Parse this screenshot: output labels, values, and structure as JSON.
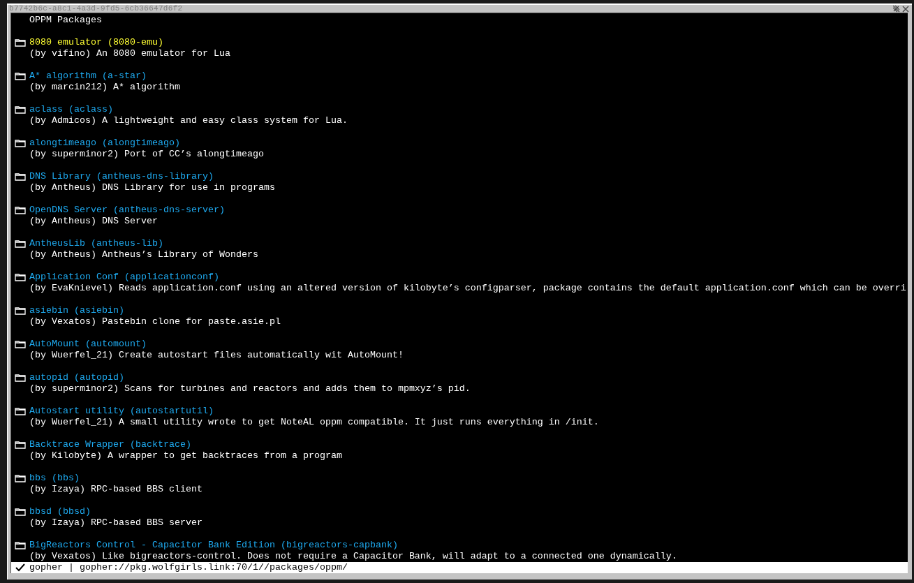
{
  "window": {
    "title": "b7742b6c-a8c1-4a3d-9fd5-6cb36647d6f2"
  },
  "heading": "OPPM Packages",
  "packages": [
    {
      "name": "8080 emulator (8080-emu)",
      "description": "(by vifino) An 8080 emulator for Lua",
      "selected": true
    },
    {
      "name": "A* algorithm (a-star)",
      "description": "(by marcin212) A* algorithm",
      "selected": false
    },
    {
      "name": "aclass (aclass)",
      "description": "(by Admicos) A lightweight and easy class system for Lua.",
      "selected": false
    },
    {
      "name": "alongtimeago (alongtimeago)",
      "description": "(by superminor2) Port of CC’s alongtimeago",
      "selected": false
    },
    {
      "name": "DNS Library (antheus-dns-library)",
      "description": "(by Antheus) DNS Library for use in programs",
      "selected": false
    },
    {
      "name": "OpenDNS Server (antheus-dns-server)",
      "description": "(by Antheus) DNS Server",
      "selected": false
    },
    {
      "name": "AntheusLib (antheus-lib)",
      "description": "(by Antheus) Antheus’s Library of Wonders",
      "selected": false
    },
    {
      "name": "Application Conf (applicationconf)",
      "description": "(by EvaKnievel) Reads application.conf using an altered version of kilobyte’s configparser, package contains the default application.conf which can be overri",
      "selected": false
    },
    {
      "name": "asiebin (asiebin)",
      "description": "(by Vexatos) Pastebin clone for paste.asie.pl",
      "selected": false
    },
    {
      "name": "AutoMount (automount)",
      "description": "(by Wuerfel_21) Create autostart files automatically wit AutoMount!",
      "selected": false
    },
    {
      "name": "autopid (autopid)",
      "description": "(by superminor2) Scans for turbines and reactors and adds them to mpmxyz’s pid.",
      "selected": false
    },
    {
      "name": "Autostart utility (autostartutil)",
      "description": "(by Wuerfel_21) A small utility wrote to get NoteAL oppm compatible. It just runs everything in /init.",
      "selected": false
    },
    {
      "name": "Backtrace Wrapper (backtrace)",
      "description": "(by Kilobyte) A wrapper to get backtraces from a program",
      "selected": false
    },
    {
      "name": "bbs (bbs)",
      "description": "(by Izaya) RPC-based BBS client",
      "selected": false
    },
    {
      "name": "bbsd (bbsd)",
      "description": "(by Izaya) RPC-based BBS server",
      "selected": false
    },
    {
      "name": "BigReactors Control - Capacitor Bank Edition (bigreactors-capbank)",
      "description": "(by Vexatos) Like bigreactors-control. Does not require a Capacitor Bank, will adapt to a connected one dynamically.",
      "selected": false
    }
  ],
  "status_bar": {
    "loaded": true,
    "text": "gopher | gopher://pkg.wolfgirls.link:70/1//packages/oppm/"
  }
}
